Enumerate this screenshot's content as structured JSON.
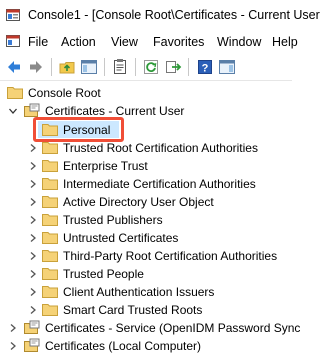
{
  "window": {
    "title": "Console1 - [Console Root\\Certificates - Current User"
  },
  "menubar": {
    "items": [
      "File",
      "Action",
      "View",
      "Favorites",
      "Window",
      "Help"
    ]
  },
  "toolbar": {
    "buttons": [
      "back-icon",
      "forward-icon",
      "up-folder-icon",
      "show-hide-tree-icon",
      "properties-icon",
      "refresh-icon",
      "export-list-icon",
      "help-icon",
      "show-action-pane-icon"
    ]
  },
  "tree": {
    "root": "Console Root",
    "current_user": "Certificates - Current User",
    "children": [
      "Personal",
      "Trusted Root Certification Authorities",
      "Enterprise Trust",
      "Intermediate Certification Authorities",
      "Active Directory User Object",
      "Trusted Publishers",
      "Untrusted Certificates",
      "Third-Party Root Certification Authorities",
      "Trusted People",
      "Client Authentication Issuers",
      "Smart Card Trusted Roots"
    ],
    "service": "Certificates - Service (OpenIDM Password Sync",
    "local_computer": "Certificates (Local Computer)",
    "selected": "Personal",
    "highlight_color": "#f04e37",
    "folder_color": "#f5d277"
  }
}
